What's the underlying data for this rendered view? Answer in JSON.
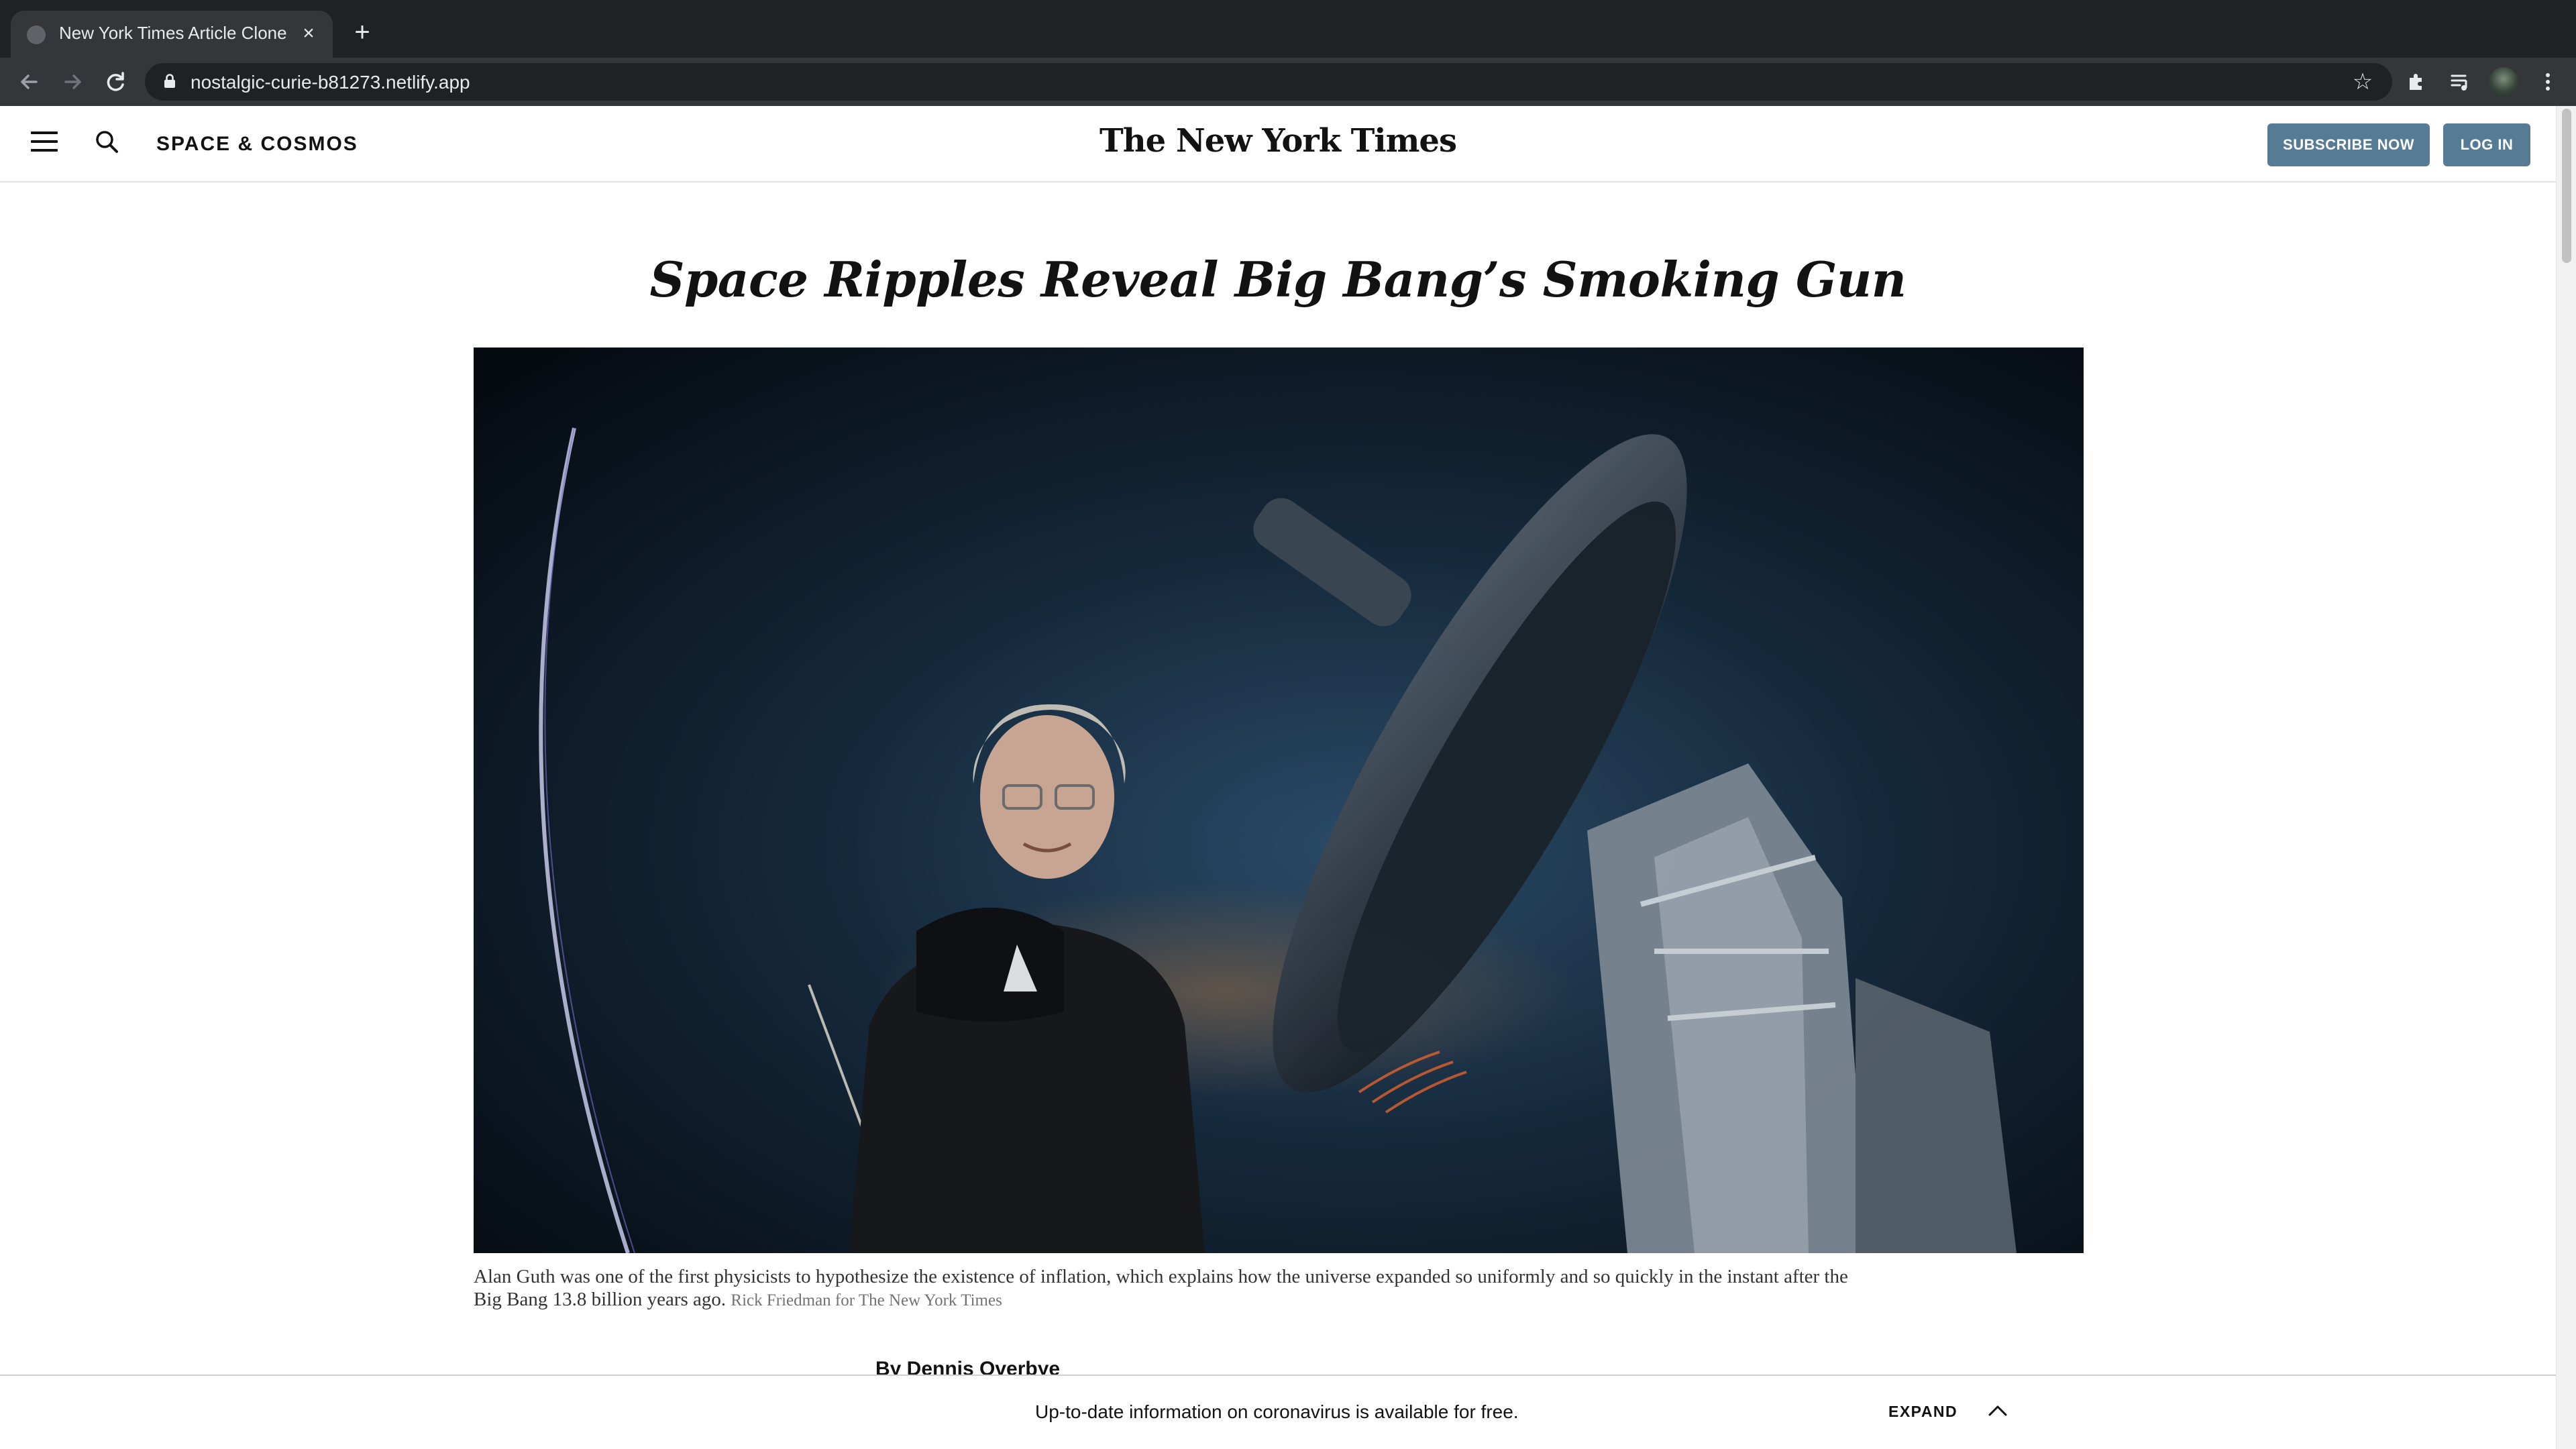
{
  "browser": {
    "tab_title": "New York Times Article Clone",
    "tab_close": "×",
    "new_tab": "+",
    "url": "nostalgic-curie-b81273.netlify.app"
  },
  "header": {
    "section": "SPACE & COSMOS",
    "masthead": "The New York Times",
    "subscribe_label": "SUBSCRIBE NOW",
    "login_label": "LOG IN"
  },
  "article": {
    "headline": "Space Ripples Reveal Big Bang’s Smoking Gun",
    "caption": "Alan Guth was one of the first physicists to hypothesize the existence of inflation, which explains how the universe expanded so uniformly and so quickly in the instant after the Big Bang 13.8 billion years ago.",
    "credit": "Rick Friedman for The New York Times",
    "byline": "By Dennis Overbye"
  },
  "banner": {
    "text": "Up-to-date information on coronavirus is available for free.",
    "expand_label": "EXPAND"
  },
  "icons": {
    "back": "arrow-left-icon",
    "forward": "arrow-right-icon",
    "reload": "reload-icon",
    "lock": "lock-icon",
    "bookmark": "star-icon",
    "extensions": "puzzle-icon",
    "media": "media-queue-icon",
    "menu": "kebab-menu-icon",
    "hamburger": "hamburger-icon",
    "search": "search-icon",
    "chevron": "chevron-up-icon"
  },
  "colors": {
    "chrome_dark": "#202124",
    "chrome_toolbar": "#35363a",
    "button_blue": "#567b95",
    "text": "#121212"
  }
}
